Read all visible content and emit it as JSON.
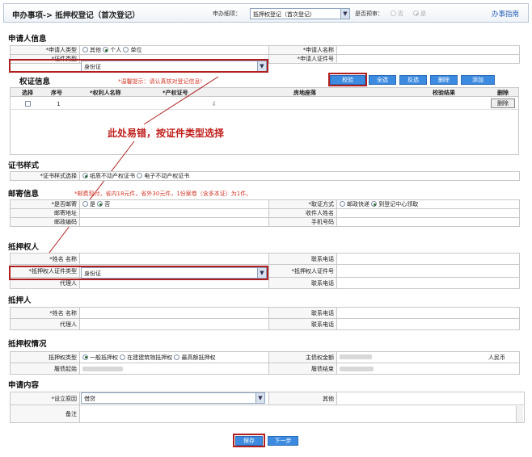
{
  "topbar": {
    "crumb": "申办事项-> 抵押权登记（首次登记）",
    "subitem_label": "申办细项：",
    "subitem_value": "抵押权登记（首次登记）",
    "preregister_label": "是否预审：",
    "no": "否",
    "yes": "是",
    "guide_link": "办事指南"
  },
  "applicant": {
    "title": "申请人信息",
    "type_label": "*申请人类型",
    "type_opts": [
      "其他",
      "个人",
      "单位"
    ],
    "name_label": "*申请人名称",
    "idtype_label": "*证件类型",
    "idtype_value": "身份证",
    "idno_label": "*申请人证件号"
  },
  "rights": {
    "title": "权证信息",
    "tip": "*温馨提示：请认真核对登记信息!",
    "buttons": [
      "校验",
      "全选",
      "反选",
      "删除",
      "添加"
    ],
    "cols": [
      "选择",
      "序号",
      "*权利人名称",
      "*产权证号",
      "房地座落",
      "校验结果",
      "删除"
    ],
    "row_no": "1",
    "row_cert": "¿",
    "row_del": "删除"
  },
  "annotation": "此处易错，按证件类型选择",
  "certstyle": {
    "title": "证书样式",
    "label": "*证书样式选择",
    "opt1": "纸质不动产权证书",
    "opt2": "电子不动产权证书"
  },
  "mail": {
    "title": "邮寄信息",
    "tip": "*邮费现付，省内18元件，省外30元件，1份案卷（含多本证）为1件。",
    "is_mail_label": "*是否邮寄",
    "yes": "是",
    "no": "否",
    "method_label": "*取证方式",
    "method_opt1": "邮政快递",
    "method_opt2": "到登记中心领取",
    "addr_label": "邮寄地址",
    "recv_label": "收件人姓名",
    "post_label": "邮政编码",
    "phone_label": "手机号码"
  },
  "mortgagee": {
    "title": "抵押权人",
    "name_label": "*姓名 名称",
    "phone_label": "联系电话",
    "idtype_label": "*抵押权人证件类型",
    "idtype_value": "身份证",
    "idno_label": "*抵押权人证件号",
    "agent_label": "代理人",
    "agent_phone_label": "联系电话"
  },
  "mortgagor": {
    "title": "抵押人",
    "name_label": "*姓名 名称",
    "phone_label": "联系电话",
    "agent_label": "代理人",
    "agent_phone_label": "联系电话"
  },
  "situation": {
    "title": "抵押权情况",
    "type_label": "抵押权类型",
    "type_opt1": "一般抵押权",
    "type_opt2": "在建建筑物抵押权",
    "type_opt3": "最高额抵押权",
    "amount_label": "主债权金额",
    "currency": "人民币",
    "start_label": "履债起始",
    "end_label": "履债结束"
  },
  "content": {
    "title": "申请内容",
    "reason_label": "*设立原因",
    "reason_value": "借贷",
    "other_label": "其他",
    "remark_label": "备注"
  },
  "footer": {
    "save": "保存",
    "next": "下一步"
  }
}
